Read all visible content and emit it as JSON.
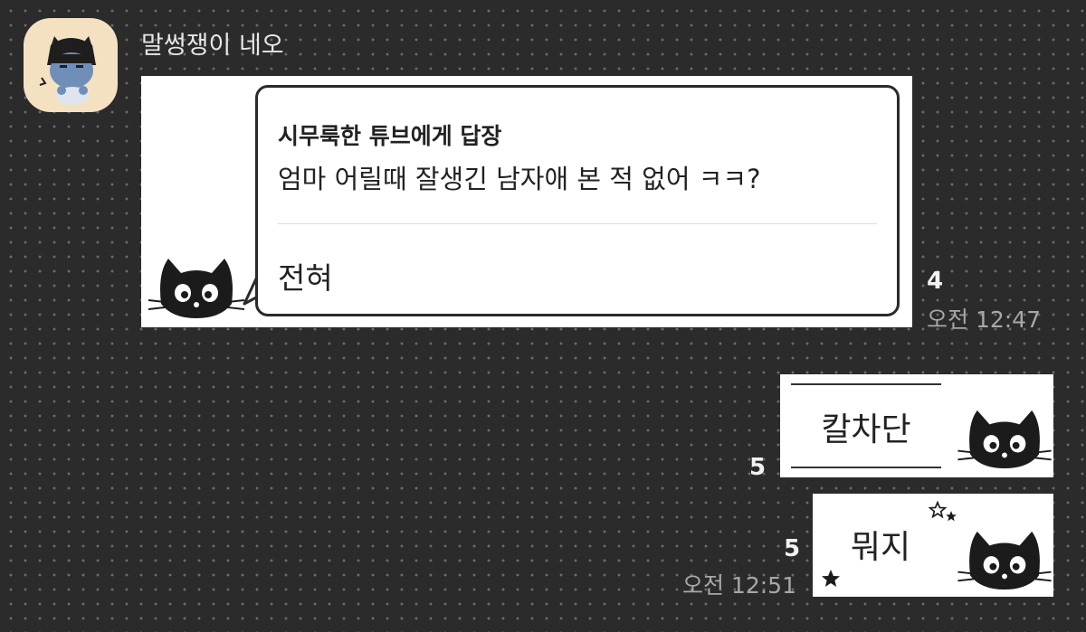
{
  "chat": {
    "sender_name": "말썽쟁이 네오",
    "messages": [
      {
        "reply_title": "시무룩한 튜브에게 답장",
        "quoted_text": "엄마 어릴때 잘생긴 남자애 본 적 없어 ㅋㅋ?",
        "text": "전혀",
        "sticker_icon": "black-cat-icon",
        "unread_count": "4",
        "time": "오전 12:47"
      },
      {
        "text": "칼차단",
        "sticker_icon": "black-cat-icon",
        "unread_count": "5"
      },
      {
        "text": "뭐지",
        "sticker_icon": "black-cat-icon",
        "unread_count": "5",
        "time": "오전 12:51"
      }
    ]
  },
  "colors": {
    "background": "#2b2b2b",
    "dots": "#6a6a6a",
    "card": "#ffffff",
    "avatar_bg": "#f4e1c2"
  }
}
